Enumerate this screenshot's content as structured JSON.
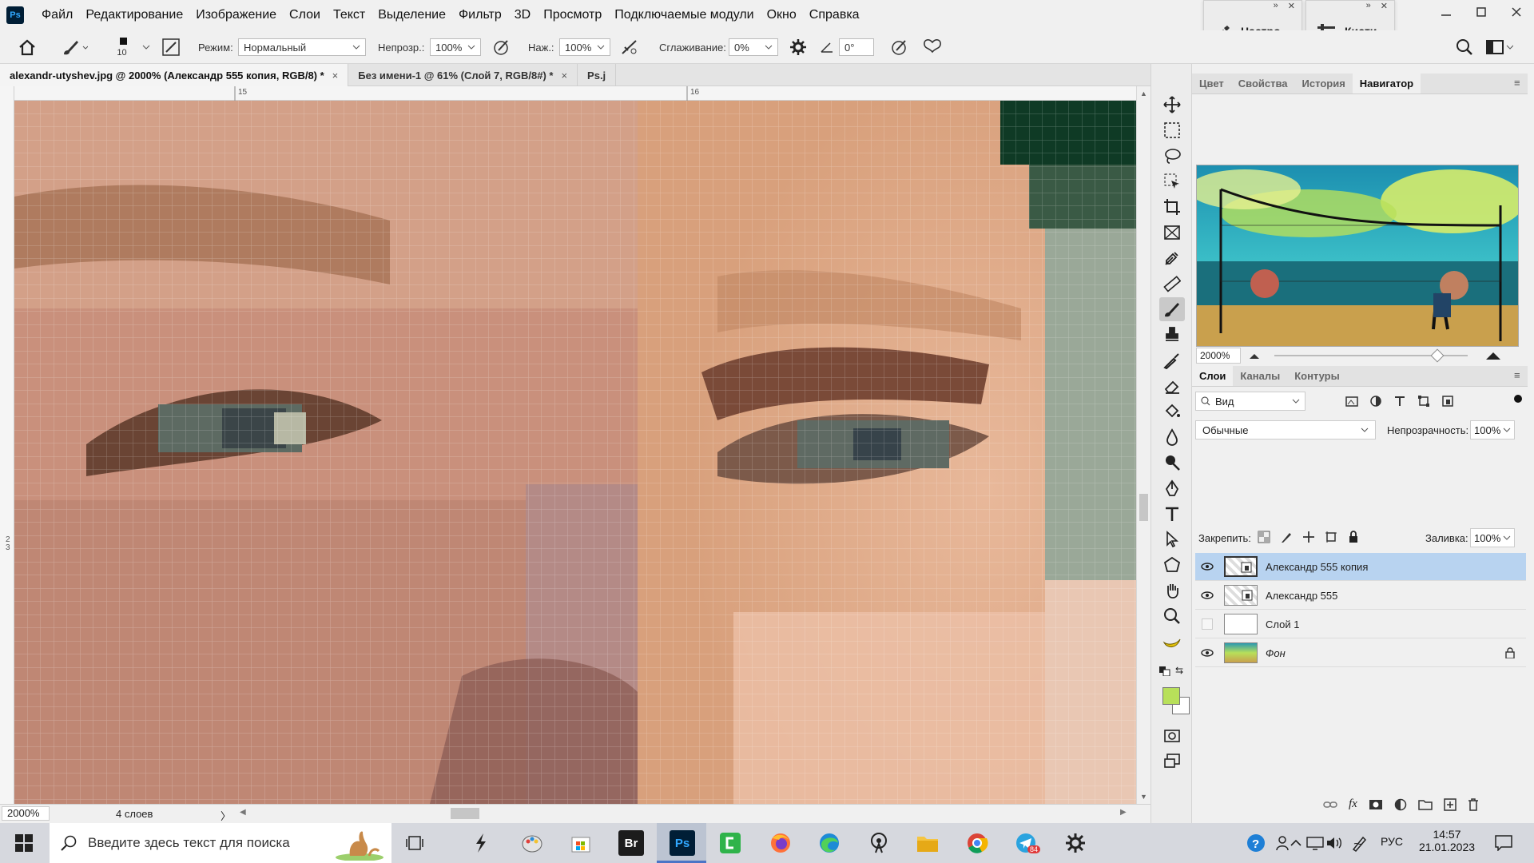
{
  "menubar": {
    "items": [
      "Файл",
      "Редактирование",
      "Изображение",
      "Слои",
      "Текст",
      "Выделение",
      "Фильтр",
      "3D",
      "Просмотр",
      "Подключаемые модули",
      "Окно",
      "Справка"
    ]
  },
  "app_logo": "Ps",
  "float_panels": {
    "adjust_label": "Настро...",
    "brushes_label": "Кисти"
  },
  "options": {
    "brush_size": "10",
    "mode_label": "Режим:",
    "mode_value": "Нормальный",
    "opacity_label": "Непрозр.:",
    "opacity_value": "100%",
    "pressure_label": "Наж.:",
    "pressure_value": "100%",
    "smoothing_label": "Сглаживание:",
    "smoothing_value": "0%",
    "angle_value": "0°"
  },
  "tabs": [
    {
      "label": "alexandr-utyshev.jpg @ 2000% (Александр 555 копия, RGB/8) *",
      "close": "×"
    },
    {
      "label": "Без имени-1 @ 61% (Слой 7, RGB/8#) *",
      "close": "×"
    },
    {
      "label": "Ps.j",
      "close": ""
    }
  ],
  "rulers": {
    "h_marks": [
      "15",
      "16"
    ],
    "v_mark_a": "2",
    "v_mark_b": "3"
  },
  "status": {
    "zoom": "2000%",
    "layers_count": "4 слоев",
    "arrow": "〉"
  },
  "panel": {
    "top_tabs": [
      "Цвет",
      "Свойства",
      "История",
      "Навигатор"
    ],
    "active_top_tab": "Навигатор",
    "nav_zoom": "2000%",
    "layer_tabs": [
      "Слои",
      "Каналы",
      "Контуры"
    ],
    "filter_label": "Вид",
    "blend_mode": "Обычные",
    "opacity_label": "Непрозрачность:",
    "opacity_value": "100%",
    "lock_label": "Закрепить:",
    "fill_label": "Заливка:",
    "fill_value": "100%",
    "layers": [
      {
        "name": "Александр 555 копия",
        "visible": true,
        "selected": true
      },
      {
        "name": "Александр 555",
        "visible": true,
        "selected": false
      },
      {
        "name": "Слой 1",
        "visible": false,
        "selected": false
      },
      {
        "name": "Фон",
        "visible": true,
        "selected": false,
        "locked": true
      }
    ]
  },
  "colors": {
    "foreground": "#b8e05a",
    "background": "#ffffff",
    "selection": "#b8d3f0",
    "ps_blue": "#31a8ff"
  },
  "taskbar": {
    "search_placeholder": "Введите здесь текст для поиска",
    "apps": [
      "task-view",
      "sketch",
      "paint",
      "store",
      "bridge",
      "photoshop",
      "camtasia",
      "firefox",
      "edge",
      "podcast",
      "explorer",
      "chrome",
      "telegram",
      "settings"
    ],
    "telegram_badge": "84",
    "bridge_label": "Br",
    "ps_label": "Ps",
    "lang": "РУС",
    "time": "14:57",
    "date": "21.01.2023"
  }
}
